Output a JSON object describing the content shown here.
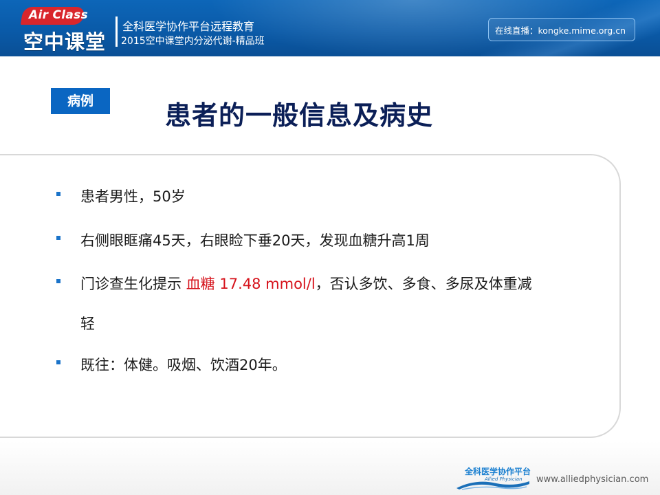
{
  "header": {
    "logo_en": "Air Class",
    "logo_cn": "空中课堂",
    "subtitle_1": "全科医学协作平台远程教育",
    "subtitle_2": "2015空中课堂内分泌代谢-精品班",
    "live": "在线直播：kongke.mime.org.cn"
  },
  "slide": {
    "tag": "病例",
    "title": "患者的一般信息及病史",
    "items": [
      {
        "text": "患者男性，50岁"
      },
      {
        "text": "右侧眼眶痛45天，右眼睑下垂20天，发现血糖升高1周"
      },
      {
        "prefix": "门诊查生化提示 ",
        "highlight": "血糖 17.48 mmol/l",
        "suffix": "，否认多饮、多食、多尿及体重减",
        "continuation": "轻"
      },
      {
        "text": "既往：体健。吸烟、饮酒20年。"
      }
    ],
    "highlight_color": "#d6121b"
  },
  "footer": {
    "logo_cn": "全科医学协作平台",
    "logo_en": "Allied Physician",
    "website": "www.alliedphysician.com"
  },
  "colors": {
    "banner": "#0a5aa8",
    "title": "#0b1f57",
    "tag_bg": "#0a66c2",
    "bullet": "#1a73c9"
  }
}
